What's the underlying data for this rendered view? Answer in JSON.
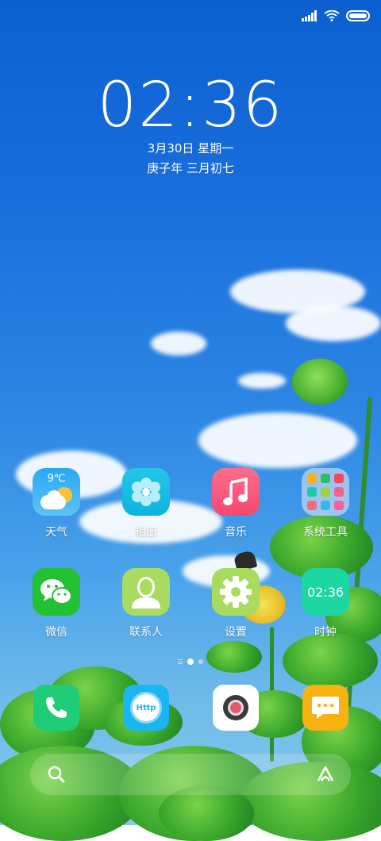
{
  "status_bar": {
    "icons": [
      "signal-icon",
      "wifi-icon",
      "battery-icon"
    ]
  },
  "lockscreen": {
    "time": "02:36",
    "date": "3月30日 星期一",
    "lunar": "庚子年 三月初七"
  },
  "apps_row1": [
    {
      "label": "天气",
      "icon": "weather-icon",
      "temp": "9℃"
    },
    {
      "label": "相册",
      "icon": "gallery-icon"
    },
    {
      "label": "音乐",
      "icon": "music-icon"
    },
    {
      "label": "系统工具",
      "icon": "folder-icon"
    }
  ],
  "apps_row2": [
    {
      "label": "微信",
      "icon": "wechat-icon"
    },
    {
      "label": "联系人",
      "icon": "contacts-icon"
    },
    {
      "label": "设置",
      "icon": "settings-icon"
    },
    {
      "label": "时钟",
      "icon": "clock-icon",
      "time": "02:36"
    }
  ],
  "dock": [
    {
      "icon": "phone-icon"
    },
    {
      "icon": "browser-icon",
      "text": "Http"
    },
    {
      "icon": "camera-icon"
    },
    {
      "icon": "messages-icon"
    }
  ],
  "page_indicator": {
    "pages": 2,
    "current": 1
  },
  "search_bar": {
    "left_icon": "search-icon",
    "right_icon": "assistant-icon"
  }
}
